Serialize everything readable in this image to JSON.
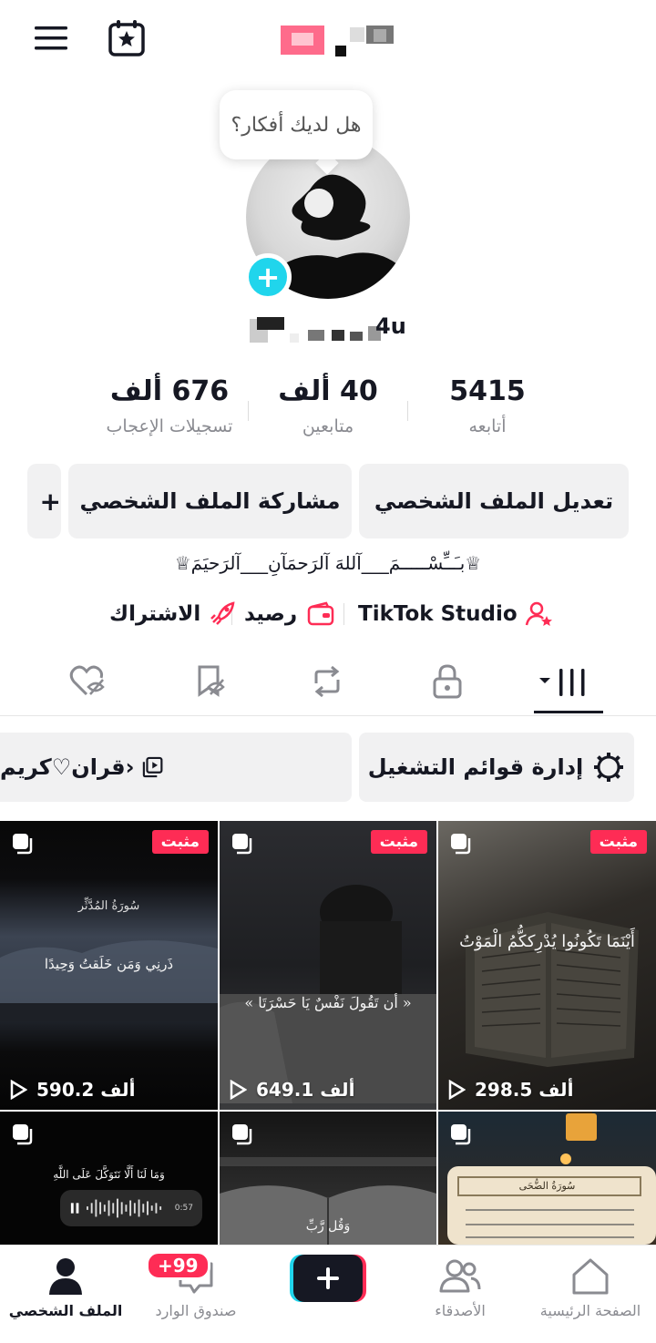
{
  "tooltip": {
    "text": "هل لديك أفكار؟"
  },
  "profile": {
    "username_suffix": "4u"
  },
  "stats": [
    {
      "value": "5415",
      "label": "أتابعه"
    },
    {
      "value": "40 ألف",
      "label": "متابعين"
    },
    {
      "value": "676 ألف",
      "label": "تسجيلات الإعجاب"
    }
  ],
  "actions": {
    "edit_profile": "تعديل الملف الشخصي",
    "share_profile": "مشاركة الملف الشخصي",
    "add_friend": "+"
  },
  "bio": "♕بـَــِّسْـــــمَ___آللهَ آلرَحمَآنِ___آلرَحيَمَ♕",
  "links": {
    "studio": "TikTok Studio",
    "balance": "رصيد",
    "subscription": "الاشتراك"
  },
  "playlists": {
    "manage": "إدارة قوائم التشغيل",
    "quran": "قران♡كريم›"
  },
  "videos": [
    {
      "pinned": "مثبت",
      "views": "298.5 ألف",
      "caption": "أَيْنَمَا تَكُونُوا يُدْرِككُّمُ الْمَوْتُ"
    },
    {
      "pinned": "مثبت",
      "views": "649.1 ألف",
      "caption": "« أن تَقُولَ نَفْسٌ يَا حَسْرَتَا »"
    },
    {
      "pinned": "مثبت",
      "views": "590.2 ألف",
      "caption": "ذَرنِي وَمَن خَلَقتُ وَحِيدًا",
      "title": "سُورَةُ المُدَّثِّر"
    },
    {
      "caption": "سُورَةُ الضُّحَى"
    },
    {
      "caption": "وَقُل رَّبِّ"
    },
    {
      "caption": "وَمَا لَنَا أَلَّا نَتَوَكَّلَ عَلَى اللَّهِ",
      "duration": "0:57"
    }
  ],
  "bottom_nav": {
    "home": "الصفحة الرئيسية",
    "friends": "الأصدقاء",
    "inbox": "صندوق الوارد",
    "inbox_badge": "+99",
    "profile": "الملف الشخصي"
  },
  "colors": {
    "accent": "#fe2c55",
    "cyan": "#20d5ec",
    "text": "#161823",
    "muted": "#8a8b91"
  }
}
